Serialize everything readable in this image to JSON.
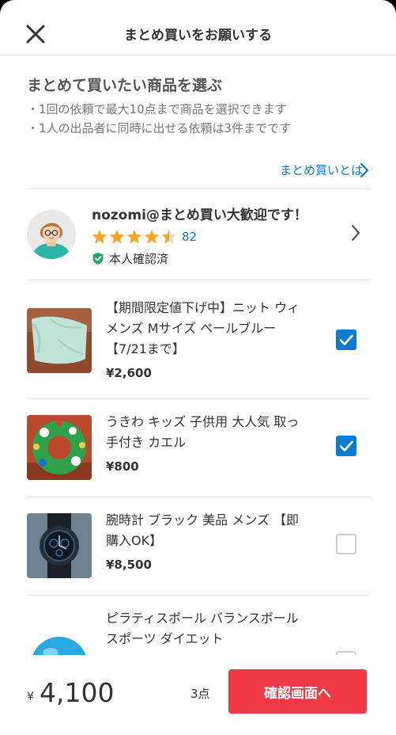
{
  "header": {
    "title": "まとめ買いをお願いする"
  },
  "intro": {
    "heading": "まとめて買いたい商品を選ぶ",
    "notes": [
      "・1回の依頼で最大10点まで商品を選択できます",
      "・1人の出品者に同時に出せる依頼は3件までです"
    ],
    "about_link": "まとめ買いとは"
  },
  "seller": {
    "name": "nozomi@まとめ買い大歓迎です！",
    "rating": 4.5,
    "review_count": "82",
    "verified_label": "本人確認済"
  },
  "items": [
    {
      "title": "【期間限定値下げ中】ニット ウィメンズ Mサイズ ペールブルー【7/21まで】",
      "price": "¥2,600",
      "checked": true
    },
    {
      "title": "うきわ キッズ 子供用 大人気 取っ手付き カエル",
      "price": "¥800",
      "checked": true
    },
    {
      "title": "腕時計 ブラック 美品 メンズ 【即購入OK】",
      "price": "¥8,500",
      "checked": false
    },
    {
      "title": "ピラティスボール バランスボール スポーツ ダイエット",
      "price": "",
      "checked": false
    }
  ],
  "footer": {
    "currency": "¥",
    "total": "4,100",
    "count": "3点",
    "confirm_label": "確認画面へ"
  },
  "colors": {
    "accent_blue": "#0a7bd0",
    "brand_red": "#f03a47",
    "star": "#f5a623",
    "verified_green": "#2aa56a"
  },
  "icons": [
    "close-icon",
    "chevron-right-icon",
    "star-icon",
    "shield-check-icon",
    "checkbox-icon"
  ]
}
